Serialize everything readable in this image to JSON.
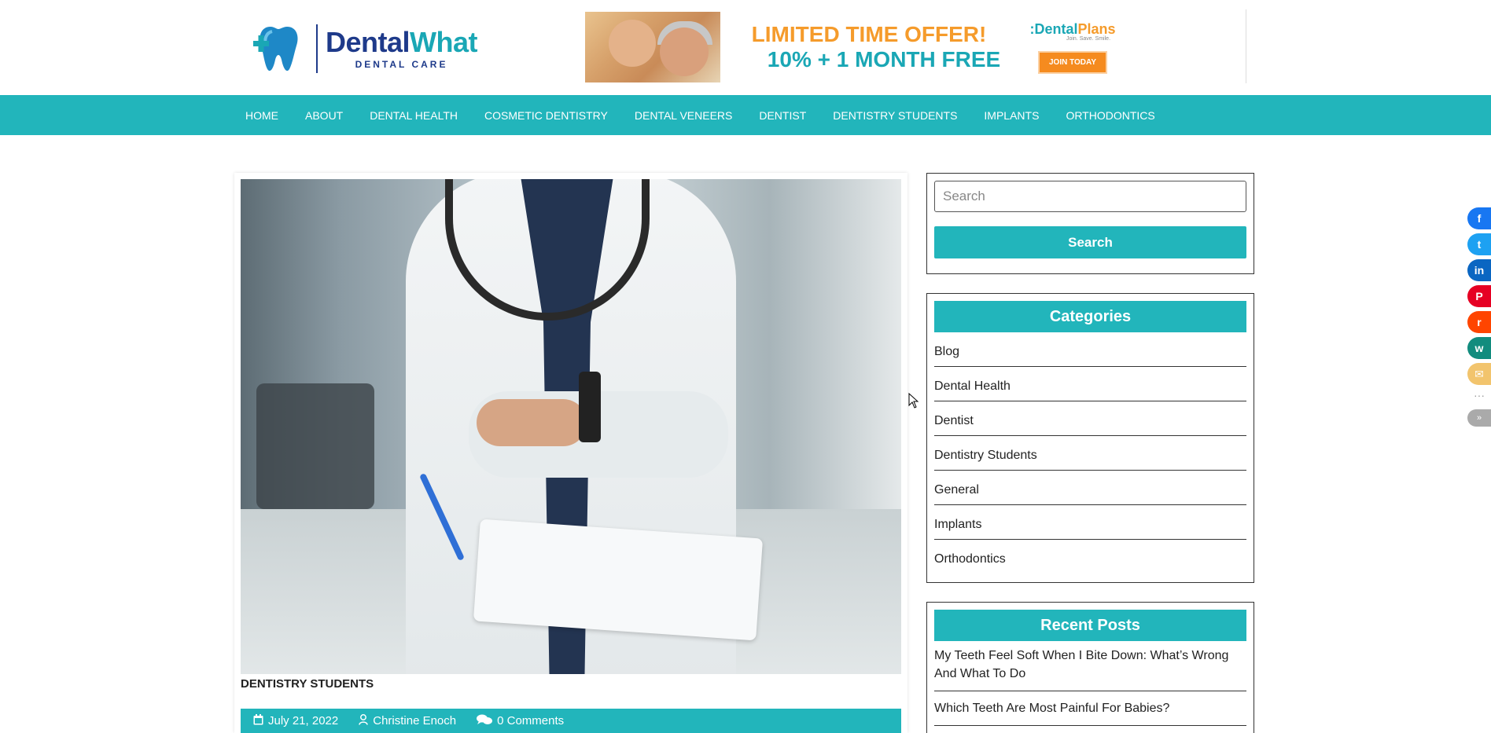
{
  "header": {
    "logo": {
      "brand_dark": "Dental",
      "brand_teal": "What",
      "tagline": "DENTAL CARE"
    },
    "banner": {
      "offer_line1": "LIMITED TIME OFFER!",
      "offer_line2": "10% + 1 MONTH FREE",
      "brand_part1": ":Dental",
      "brand_part2": "Plans",
      "brand_tagline": "Join. Save. Smile.",
      "cta_label": "JOIN TODAY"
    }
  },
  "nav": {
    "items": [
      "HOME",
      "ABOUT",
      "DENTAL HEALTH",
      "COSMETIC DENTISTRY",
      "DENTAL VENEERS",
      "DENTIST",
      "DENTISTRY STUDENTS",
      "IMPLANTS",
      "ORTHODONTICS"
    ]
  },
  "article": {
    "category": "DENTISTRY STUDENTS",
    "date": "July 21, 2022",
    "author": "Christine Enoch",
    "comments": "0 Comments"
  },
  "sidebar": {
    "search": {
      "placeholder": "Search",
      "button_label": "Search"
    },
    "categories": {
      "title": "Categories",
      "items": [
        "Blog",
        "Dental Health",
        "Dentist",
        "Dentistry Students",
        "General",
        "Implants",
        "Orthodontics"
      ]
    },
    "recent_posts": {
      "title": "Recent Posts",
      "items": [
        "My Teeth Feel Soft When I Bite Down: What’s Wrong And What To Do",
        "Which Teeth Are Most Painful For Babies?"
      ]
    }
  },
  "share": {
    "buttons": [
      {
        "name": "facebook",
        "color": "#1877f2",
        "glyph": "f"
      },
      {
        "name": "twitter",
        "color": "#1da1f2",
        "glyph": "t"
      },
      {
        "name": "linkedin",
        "color": "#0a66c2",
        "glyph": "in"
      },
      {
        "name": "pinterest",
        "color": "#e60023",
        "glyph": "P"
      },
      {
        "name": "reddit",
        "color": "#ff4500",
        "glyph": "r"
      },
      {
        "name": "whatsapp",
        "color": "#128c7e",
        "glyph": "w"
      },
      {
        "name": "email",
        "color": "#f2c46d",
        "glyph": "✉"
      }
    ],
    "more": "···",
    "toggle": "»"
  },
  "colors": {
    "accent": "#22b5bb",
    "brand_dark": "#1e3a8a",
    "offer_orange": "#f59b2b"
  }
}
